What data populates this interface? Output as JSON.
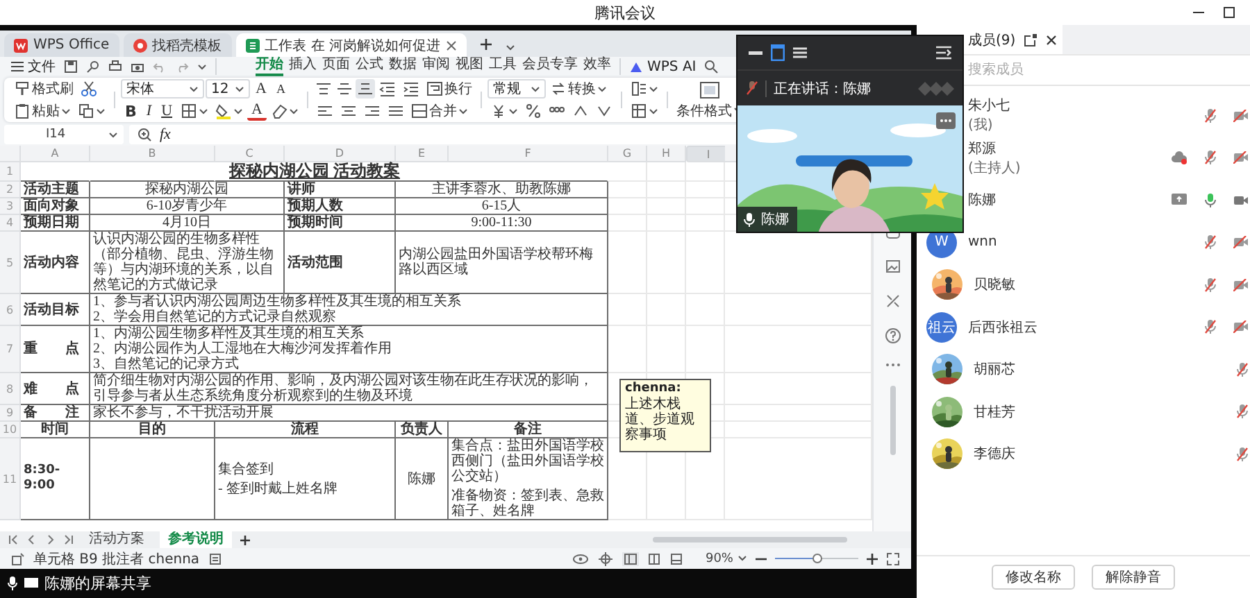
{
  "window": {
    "title": "腾讯会议"
  },
  "wps": {
    "tabs": [
      {
        "label": "WPS Office",
        "kind": "home",
        "selected": false
      },
      {
        "label": "找稻壳模板",
        "kind": "template",
        "selected": false
      },
      {
        "label": "工作表 在 河岗解说如何促进",
        "kind": "sheet",
        "selected": true
      }
    ],
    "menu": {
      "file": "文件",
      "items": [
        {
          "label": "开始",
          "selected": true
        },
        {
          "label": "插入",
          "selected": false
        },
        {
          "label": "页面",
          "selected": false
        },
        {
          "label": "公式",
          "selected": false
        },
        {
          "label": "数据",
          "selected": false
        },
        {
          "label": "审阅",
          "selected": false
        },
        {
          "label": "视图",
          "selected": false
        },
        {
          "label": "工具",
          "selected": false
        },
        {
          "label": "会员专享",
          "selected": false
        },
        {
          "label": "效率",
          "selected": false
        }
      ],
      "ai": "WPS AI"
    },
    "ribbon": {
      "format_painter": "格式刷",
      "paste": "粘贴",
      "font": "宋体",
      "font_size": "12",
      "size_buttons": [
        "A",
        "A"
      ],
      "style_buttons": [
        "B",
        "I",
        "U"
      ],
      "font_color": "A",
      "wrap": "换行",
      "merge": "合并",
      "number_format": "常规",
      "convert": "转换",
      "conditional_format": "条件格式"
    },
    "formula_bar": {
      "cell": "I14",
      "fx": "fx"
    },
    "sheet": {
      "columns": [
        "A",
        "B",
        "C",
        "D",
        "E",
        "F",
        "G",
        "H",
        "I"
      ],
      "rows": [
        {
          "number": "1",
          "kind": "title",
          "cells": [
            null,
            null,
            "探秘内湖公园 活动教案"
          ]
        },
        {
          "number": "2",
          "kind": "pair",
          "cells": [
            "活动主题",
            "探秘内湖公园",
            "讲师",
            "主讲李蓉水、助教陈娜"
          ]
        },
        {
          "number": "3",
          "kind": "pair",
          "cells": [
            "面向对象",
            "6-10岁青少年",
            "预期人数",
            "6-15人"
          ]
        },
        {
          "number": "4",
          "kind": "pair",
          "cells": [
            "预期日期",
            "4月10日",
            "预期时间",
            "9:00-11:30"
          ]
        },
        {
          "number": "5",
          "kind": "pair",
          "cells": [
            "活动内容",
            "认识内湖公园的生物多样性（部分植物、昆虫、浮游生物等）与内湖环境的关系，以自然笔记的方式做记录",
            "活动范围",
            "内湖公园盐田外国语学校帮环梅路以西区域"
          ]
        },
        {
          "number": "6",
          "kind": "wide",
          "cells": [
            "活动目标",
            [
              "1、参与者认识内湖公园周边生物多样性及其生境的相互关系",
              "2、学会用自然笔记的方式记录自然观察"
            ]
          ]
        },
        {
          "number": "7",
          "kind": "wide",
          "cells": [
            "重　　点",
            [
              "1、内湖公园生物多样性及其生境的相互关系",
              "2、内湖公园作为人工湿地在大梅沙河发挥着作用",
              "3、自然笔记的记录方式"
            ]
          ]
        },
        {
          "number": "8",
          "kind": "wide",
          "cells": [
            "难　　点",
            "简介细生物对内湖公园的作用、影响，及内湖公园对该生物在此生存状况的影响，引导参与者从生态系统角度分析观察到的生物及环境"
          ]
        },
        {
          "number": "9",
          "kind": "wide",
          "cells": [
            "备　　注",
            "家长不参与，不干扰活动开展"
          ]
        },
        {
          "number": "10",
          "kind": "header",
          "cells": [
            "时间",
            "目的",
            "流程",
            "负责人",
            "备注"
          ]
        },
        {
          "number": "11",
          "kind": "schedule",
          "cells": [
            "8:30-9:00",
            null,
            [
              "集合签到",
              "- 签到时戴上姓名牌"
            ],
            "陈娜",
            [
              "集合点：盐田外国语学校西侧门（盐田外国语学校公交站）",
              "准备物资：签到表、急救箱子、姓名牌"
            ]
          ]
        }
      ]
    },
    "comment": {
      "author": "chenna:",
      "text": "上述木栈道、步道观察事项"
    },
    "sheet_tabs": [
      {
        "label": "活动方案",
        "selected": false
      },
      {
        "label": "参考说明",
        "selected": true
      }
    ],
    "status_bar": {
      "cell_info": "单元格 B9 批注者 chenna",
      "zoom": "90%",
      "zoom_slider": {
        "level": 0.5
      }
    }
  },
  "share_bar": {
    "label": "陈娜的屏幕共享"
  },
  "video": {
    "speaking": "正在讲话：陈娜",
    "speaker": "陈娜",
    "mic_muted": true
  },
  "members_panel": {
    "title": "成员(9)",
    "search": {
      "placeholder": "搜索成员"
    },
    "members": [
      {
        "name": "朱小七",
        "note": "(我)",
        "muted": true,
        "video_on": false,
        "sharing": false,
        "recording": false
      },
      {
        "name": "郑源",
        "note": "(主持人)",
        "muted": true,
        "video_on": false,
        "sharing": false,
        "recording": true
      },
      {
        "name": "陈娜",
        "muted": false,
        "video_on": true,
        "sharing": true,
        "recording": false
      },
      {
        "name": "wnn",
        "avatar": {
          "kind": "letter",
          "text": "W"
        },
        "muted": true,
        "video_on": false,
        "sharing": false,
        "recording": false
      },
      {
        "name": "贝晓敏",
        "muted": true,
        "video_on": false,
        "sharing": false,
        "recording": false
      },
      {
        "name": "后西张祖云",
        "avatar": {
          "kind": "letter",
          "text": "祖云"
        },
        "muted": true,
        "video_on": false,
        "sharing": false,
        "recording": false
      },
      {
        "name": "胡丽芯",
        "muted": true,
        "sharing": false,
        "recording": false
      },
      {
        "name": "甘桂芳",
        "muted": true,
        "sharing": false,
        "recording": false
      },
      {
        "name": "李德庆",
        "muted": true,
        "sharing": false,
        "recording": false
      }
    ],
    "buttons": [
      "修改名称",
      "解除静音"
    ]
  }
}
